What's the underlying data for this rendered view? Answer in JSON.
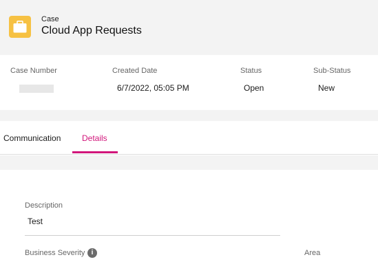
{
  "header": {
    "object_label": "Case",
    "title": "Cloud App Requests",
    "icon": "briefcase-icon",
    "icon_color": "#f6c143"
  },
  "highlights": {
    "case_number_label": "Case Number",
    "case_number_value": "",
    "created_date_label": "Created Date",
    "created_date_value": "6/7/2022, 05:05 PM",
    "status_label": "Status",
    "status_value": "Open",
    "sub_status_label": "Sub-Status",
    "sub_status_value": "New"
  },
  "tabs": [
    {
      "label": "Communication",
      "active": false
    },
    {
      "label": "Details",
      "active": true
    }
  ],
  "accent_color": "#d1157a",
  "details": {
    "description_label": "Description",
    "description_value": "Test",
    "business_severity_label": "Business Severity",
    "business_severity_info_icon": "info-icon",
    "area_label": "Area"
  }
}
